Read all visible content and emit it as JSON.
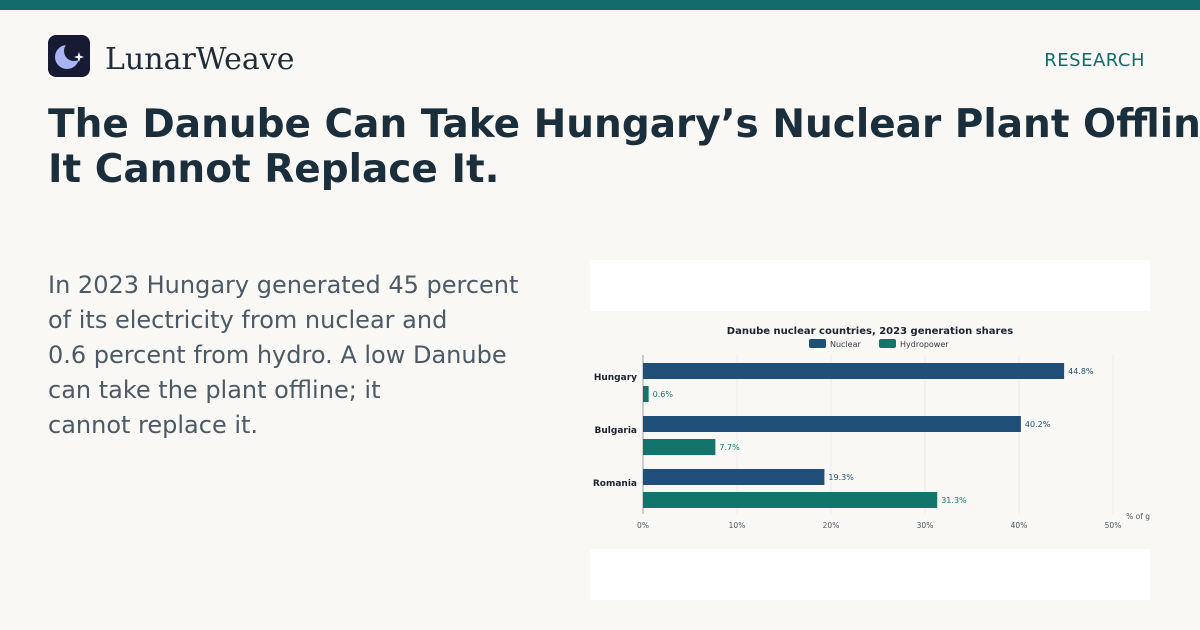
{
  "brand": {
    "name": "LunarWeave",
    "logo_icon": "moon-star-icon",
    "logo_bg": "#161b33",
    "logo_moon": "#a9b4f5"
  },
  "section": {
    "label": "RESEARCH"
  },
  "headline": {
    "lines": [
      "The Danube Can Take Hungary’s Nuclear Plant Offline.",
      "It Cannot Replace It."
    ]
  },
  "body": {
    "lines": [
      "In 2023 Hungary generated 45 percent",
      "of its electricity from nuclear and",
      "0.6 percent from hydro. A low Danube",
      "can take the plant offline; it",
      "cannot replace it."
    ]
  },
  "colors": {
    "accent": "#136c6c",
    "nuclear": "#1f4e79",
    "hydro": "#12756b"
  },
  "chart_data": {
    "type": "bar",
    "orientation": "horizontal",
    "title": "Danube nuclear countries, 2023 generation shares",
    "categories": [
      "Hungary",
      "Bulgaria",
      "Romania"
    ],
    "series": [
      {
        "name": "Nuclear",
        "values": [
          44.8,
          40.2,
          19.3
        ],
        "labels": [
          "44.8%",
          "40.2%",
          "19.3%"
        ]
      },
      {
        "name": "Hydropower",
        "values": [
          0.6,
          7.7,
          31.3
        ],
        "labels": [
          "0.6%",
          "7.7%",
          "31.3%"
        ]
      }
    ],
    "xlim": [
      0,
      50
    ],
    "xticks": [
      0,
      10,
      20,
      30,
      40,
      50
    ],
    "xtick_labels": [
      "0%",
      "10%",
      "20%",
      "30%",
      "40%",
      "50%"
    ],
    "xlabel": "% of g",
    "legend": "top-center",
    "grid": true
  }
}
